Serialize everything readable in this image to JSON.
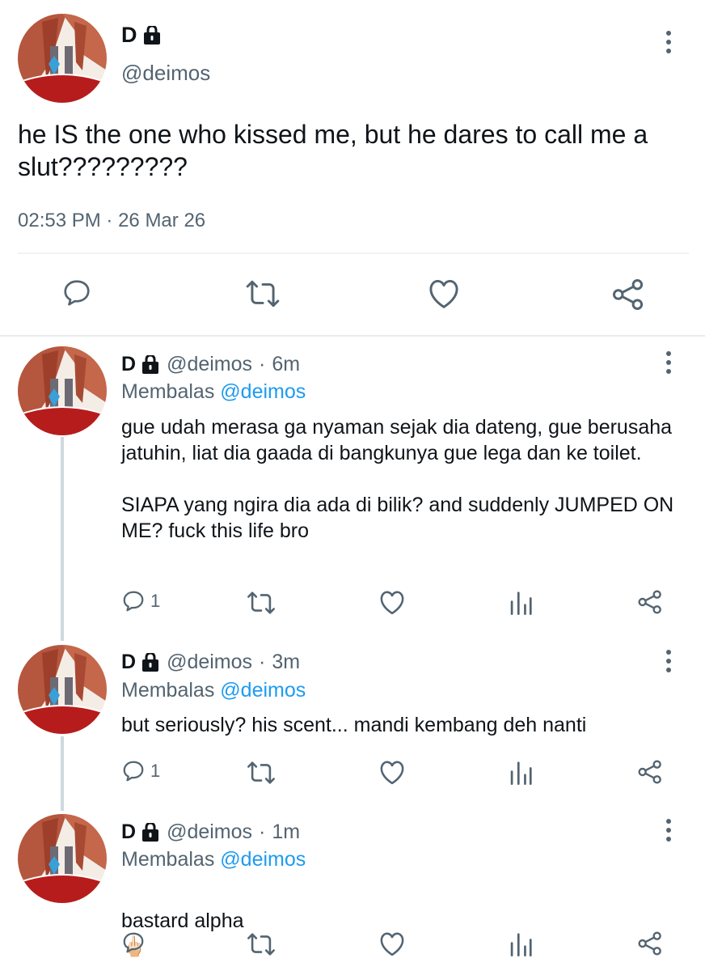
{
  "main_tweet": {
    "display_name": "D",
    "handle": "@deimos",
    "text": "he IS the one who kissed me, but he dares to call me a slut?????????",
    "time": "02:53 PM",
    "separator": "·",
    "date": "26 Mar 26"
  },
  "replies": [
    {
      "display_name": "D",
      "handle": "@deimos",
      "sep": "·",
      "time": "6m",
      "replying_prefix": "Membalas",
      "replying_to": "@deimos",
      "text": "gue udah merasa ga nyaman sejak dia dateng, gue berusaha jatuhin, liat dia gaada di bangkunya gue lega dan ke toilet.\n\nSIAPA yang ngira dia ada di bilik? and suddenly JUMPED ON ME? fuck this life bro",
      "reply_count": "1"
    },
    {
      "display_name": "D",
      "handle": "@deimos",
      "sep": "·",
      "time": "3m",
      "replying_prefix": "Membalas",
      "replying_to": "@deimos",
      "text": "but seriously? his scent... mandi kembang deh nanti",
      "reply_count": "1"
    },
    {
      "display_name": "D",
      "handle": "@deimos",
      "sep": "·",
      "time": "1m",
      "replying_prefix": "Membalas",
      "replying_to": "@deimos",
      "text": "bastard alpha",
      "emoji": "🖕🏻",
      "reply_count": ""
    }
  ],
  "colors": {
    "accent": "#1d9bf0",
    "muted": "#536471",
    "text": "#0f1419"
  }
}
